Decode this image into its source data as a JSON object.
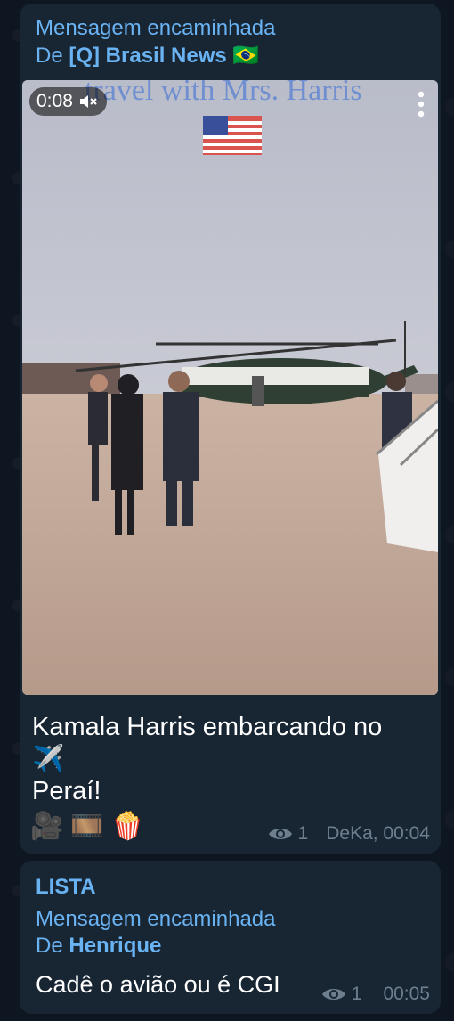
{
  "messages": [
    {
      "forward_label": "Mensagem encaminhada",
      "forward_from_prefix": "De",
      "forward_from_name": "[Q] Brasil News",
      "forward_flag": "🇧🇷",
      "video": {
        "duration": "0:08",
        "muted_icon": "speaker-muted-icon",
        "overlay_text": "travel with Mrs. Harris"
      },
      "caption_line1": "Kamala Harris embarcando no",
      "caption_emoji1": "✈️",
      "caption_line2": "Peraí!",
      "caption_emojis": [
        "🎥",
        "🎞️",
        "🍿"
      ],
      "views": "1",
      "signature_time": "DeKa, 00:04"
    },
    {
      "title": "LISTA",
      "forward_label": "Mensagem encaminhada",
      "forward_from_prefix": "De",
      "forward_from_name": "Henrique",
      "text": "Cadê o avião ou é CGI",
      "views": "1",
      "time": "00:05"
    }
  ],
  "colors": {
    "background": "#0e1621",
    "bubble": "#182533",
    "accent": "#6ab3f3",
    "meta": "#6d7f8f"
  }
}
